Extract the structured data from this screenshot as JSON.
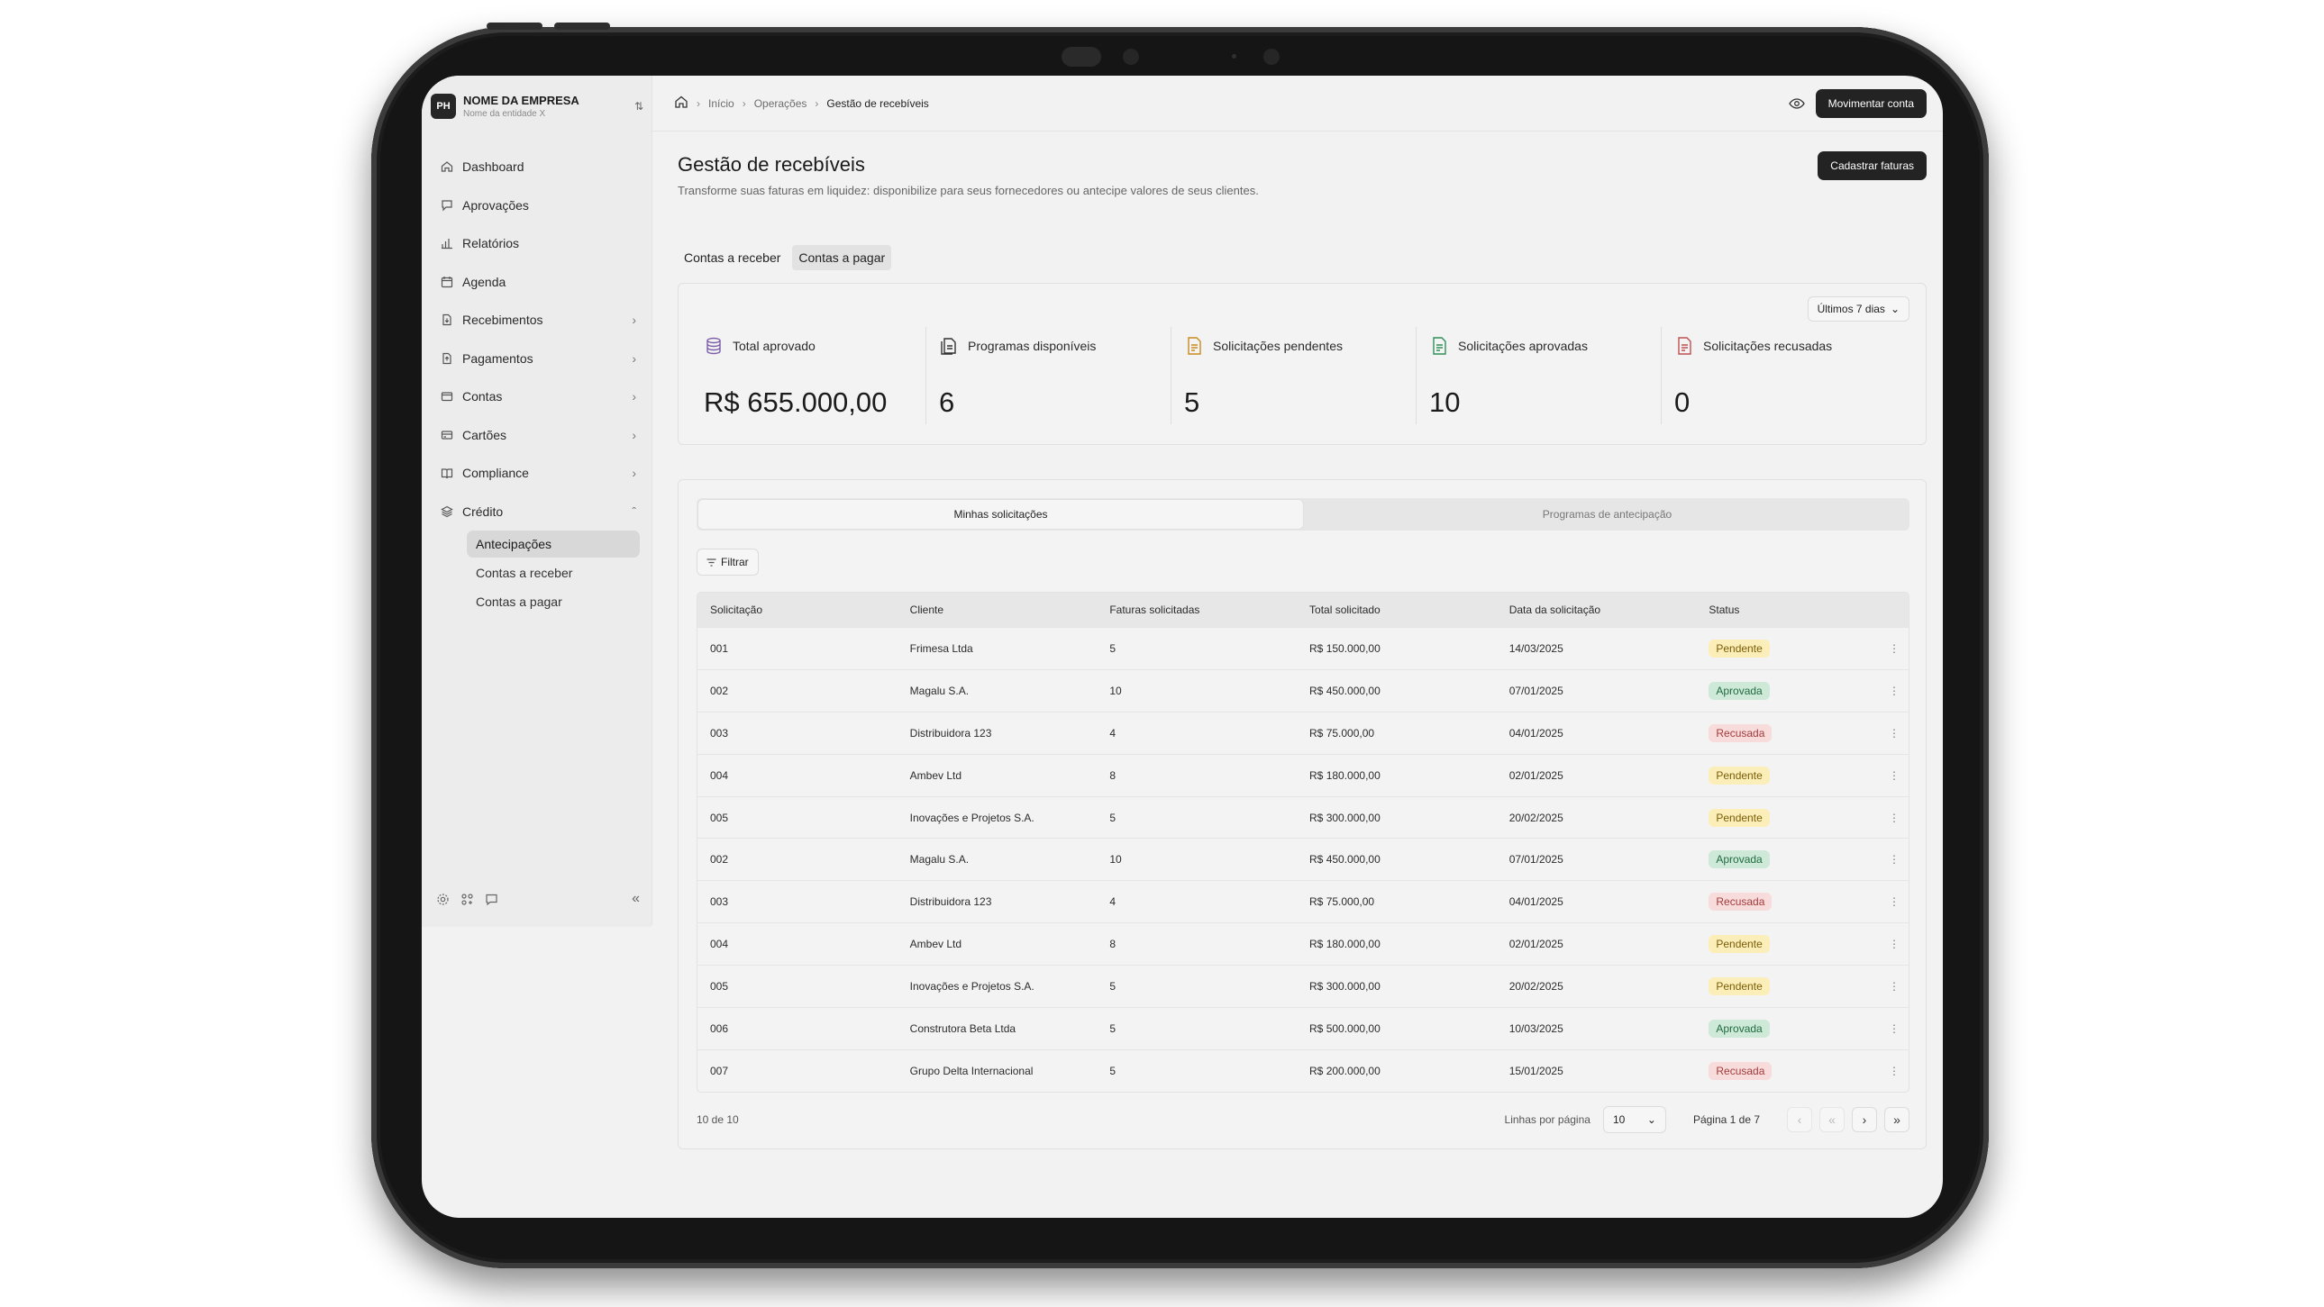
{
  "org": {
    "avatar": "PH",
    "name": "NOME DA EMPRESA",
    "entity": "Nome da entidade X"
  },
  "nav": {
    "items": [
      {
        "label": "Dashboard",
        "icon": "home-icon",
        "expandable": false
      },
      {
        "label": "Aprovações",
        "icon": "message-check-icon",
        "expandable": false
      },
      {
        "label": "Relatórios",
        "icon": "bar-chart-icon",
        "expandable": false
      },
      {
        "label": "Agenda",
        "icon": "calendar-icon",
        "expandable": false
      },
      {
        "label": "Recebimentos",
        "icon": "file-in-icon",
        "expandable": true
      },
      {
        "label": "Pagamentos",
        "icon": "file-out-icon",
        "expandable": true
      },
      {
        "label": "Contas",
        "icon": "wallet-icon",
        "expandable": true
      },
      {
        "label": "Cartões",
        "icon": "credit-card-icon",
        "expandable": true
      },
      {
        "label": "Compliance",
        "icon": "book-icon",
        "expandable": true
      },
      {
        "label": "Crédito",
        "icon": "layers-icon",
        "expandable": true,
        "expanded": true
      }
    ],
    "credit_sub": [
      "Antecipações",
      "Contas a receber",
      "Contas a pagar"
    ]
  },
  "breadcrumb": [
    "Início",
    "Operações",
    "Gestão de recebíveis"
  ],
  "topbar": {
    "primary_button": "Movimentar conta"
  },
  "page": {
    "title": "Gestão de recebíveis",
    "description": "Transforme suas faturas em liquidez: disponibilize para seus fornecedores ou antecipe valores de seus clientes.",
    "cta": "Cadastrar faturas",
    "tabs": [
      "Contas a receber",
      "Contas a pagar"
    ],
    "range": "Últimos 7 dias"
  },
  "stats": [
    {
      "label": "Total aprovado",
      "value": "R$ 655.000,00",
      "icon": "database-icon",
      "color": "#7b5ea7"
    },
    {
      "label": "Programas disponíveis",
      "value": "6",
      "icon": "document-stack-icon",
      "color": "#333333"
    },
    {
      "label": "Solicitações pendentes",
      "value": "5",
      "icon": "document-pending-icon",
      "color": "#c98a1e"
    },
    {
      "label": "Solicitações aprovadas",
      "value": "10",
      "icon": "document-approved-icon",
      "color": "#2f8f57"
    },
    {
      "label": "Solicitações recusadas",
      "value": "0",
      "icon": "document-rejected-icon",
      "color": "#c05050"
    }
  ],
  "segments": [
    "Minhas solicitações",
    "Programas de antecipação"
  ],
  "filter_label": "Filtrar",
  "table": {
    "columns": [
      "Solicitação",
      "Cliente",
      "Faturas solicitadas",
      "Total solicitado",
      "Data  da solicitação",
      "Status"
    ],
    "rows": [
      [
        "001",
        "Frimesa Ltda",
        "5",
        "R$ 150.000,00",
        "14/03/2025",
        "Pendente"
      ],
      [
        "002",
        "Magalu S.A.",
        "10",
        "R$ 450.000,00",
        "07/01/2025",
        "Aprovada"
      ],
      [
        "003",
        "Distribuidora 123",
        "4",
        "R$ 75.000,00",
        "04/01/2025",
        "Recusada"
      ],
      [
        "004",
        "Ambev Ltd",
        "8",
        "R$ 180.000,00",
        "02/01/2025",
        "Pendente"
      ],
      [
        "005",
        "Inovações e Projetos S.A.",
        "5",
        "R$ 300.000,00",
        "20/02/2025",
        "Pendente"
      ],
      [
        "002",
        "Magalu S.A.",
        "10",
        "R$ 450.000,00",
        "07/01/2025",
        "Aprovada"
      ],
      [
        "003",
        "Distribuidora 123",
        "4",
        "R$ 75.000,00",
        "04/01/2025",
        "Recusada"
      ],
      [
        "004",
        "Ambev Ltd",
        "8",
        "R$ 180.000,00",
        "02/01/2025",
        "Pendente"
      ],
      [
        "005",
        "Inovações e Projetos S.A.",
        "5",
        "R$ 300.000,00",
        "20/02/2025",
        "Pendente"
      ],
      [
        "006",
        "Construtora Beta Ltda",
        "5",
        "R$ 500.000,00",
        "10/03/2025",
        "Aprovada"
      ],
      [
        "007",
        "Grupo Delta Internacional",
        "5",
        "R$ 200.000,00",
        "15/01/2025",
        "Recusada"
      ]
    ]
  },
  "footer": {
    "count": "10 de 10",
    "rows_label": "Linhas por página",
    "rows_value": "10",
    "page_label": "Página 1 de 7"
  }
}
